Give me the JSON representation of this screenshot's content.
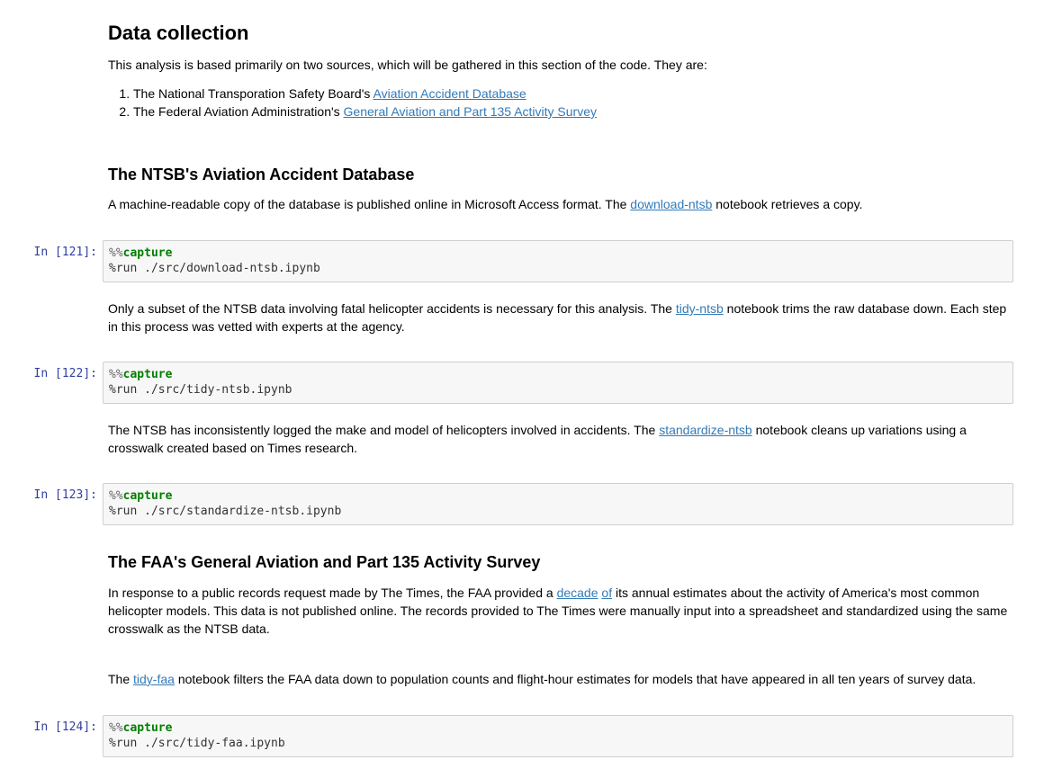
{
  "cells": {
    "data_collection": {
      "heading": "Data collection",
      "intro": "This analysis is based primarily on two sources, which will be gathered in this section of the code. They are:",
      "sources": [
        {
          "prefix": "The National Transporation Safety Board's ",
          "link": "Aviation Accident Database"
        },
        {
          "prefix": "The Federal Aviation Administration's ",
          "link": "General Aviation and Part 135 Activity Survey"
        }
      ]
    },
    "ntsb": {
      "heading": "The NTSB's Aviation Accident Database",
      "p1_before": "A machine-readable copy of the database is published online in Microsoft Access format. The ",
      "p1_link": "download-ntsb",
      "p1_after": " notebook retrieves a copy.",
      "p2_before": "Only a subset of the NTSB data involving fatal helicopter accidents is necessary for this analysis. The ",
      "p2_link": "tidy-ntsb",
      "p2_after": " notebook trims the raw database down. Each step in this process was vetted with experts at the agency.",
      "p3_before": "The NTSB has inconsistently logged the make and model of helicopters involved in accidents. The ",
      "p3_link": "standardize-ntsb",
      "p3_after": " notebook cleans up variations using a crosswalk created based on Times research."
    },
    "faa": {
      "heading": "The FAA's General Aviation and Part 135 Activity Survey",
      "p1_before": "In response to a public records request made by The Times, the FAA provided a ",
      "p1_link1": "decade",
      "p1_link2": "of",
      "p1_after": " its annual estimates about the activity of America's most common helicopter models. This data is not published online. The records provided to The Times were manually input into a spreadsheet and standardized using the same crosswalk as the NTSB data.",
      "p2_before": "The ",
      "p2_link": "tidy-faa",
      "p2_after": " notebook filters the FAA data down to population counts and flight-hour estimates for models that have appeared in all ten years of survey data."
    }
  },
  "code_cells": [
    {
      "prompt": "In [121]:",
      "magic_pct": "%%",
      "magic_kw": "capture",
      "line2": "%run ./src/download-ntsb.ipynb"
    },
    {
      "prompt": "In [122]:",
      "magic_pct": "%%",
      "magic_kw": "capture",
      "line2": "%run ./src/tidy-ntsb.ipynb"
    },
    {
      "prompt": "In [123]:",
      "magic_pct": "%%",
      "magic_kw": "capture",
      "line2": "%run ./src/standardize-ntsb.ipynb"
    },
    {
      "prompt": "In [124]:",
      "magic_pct": "%%",
      "magic_kw": "capture",
      "line2": "%run ./src/tidy-faa.ipynb"
    }
  ],
  "colors": {
    "link": "#337ab7",
    "prompt": "#303f9f",
    "magic_keyword": "#008000",
    "code_background": "#f7f7f7"
  }
}
